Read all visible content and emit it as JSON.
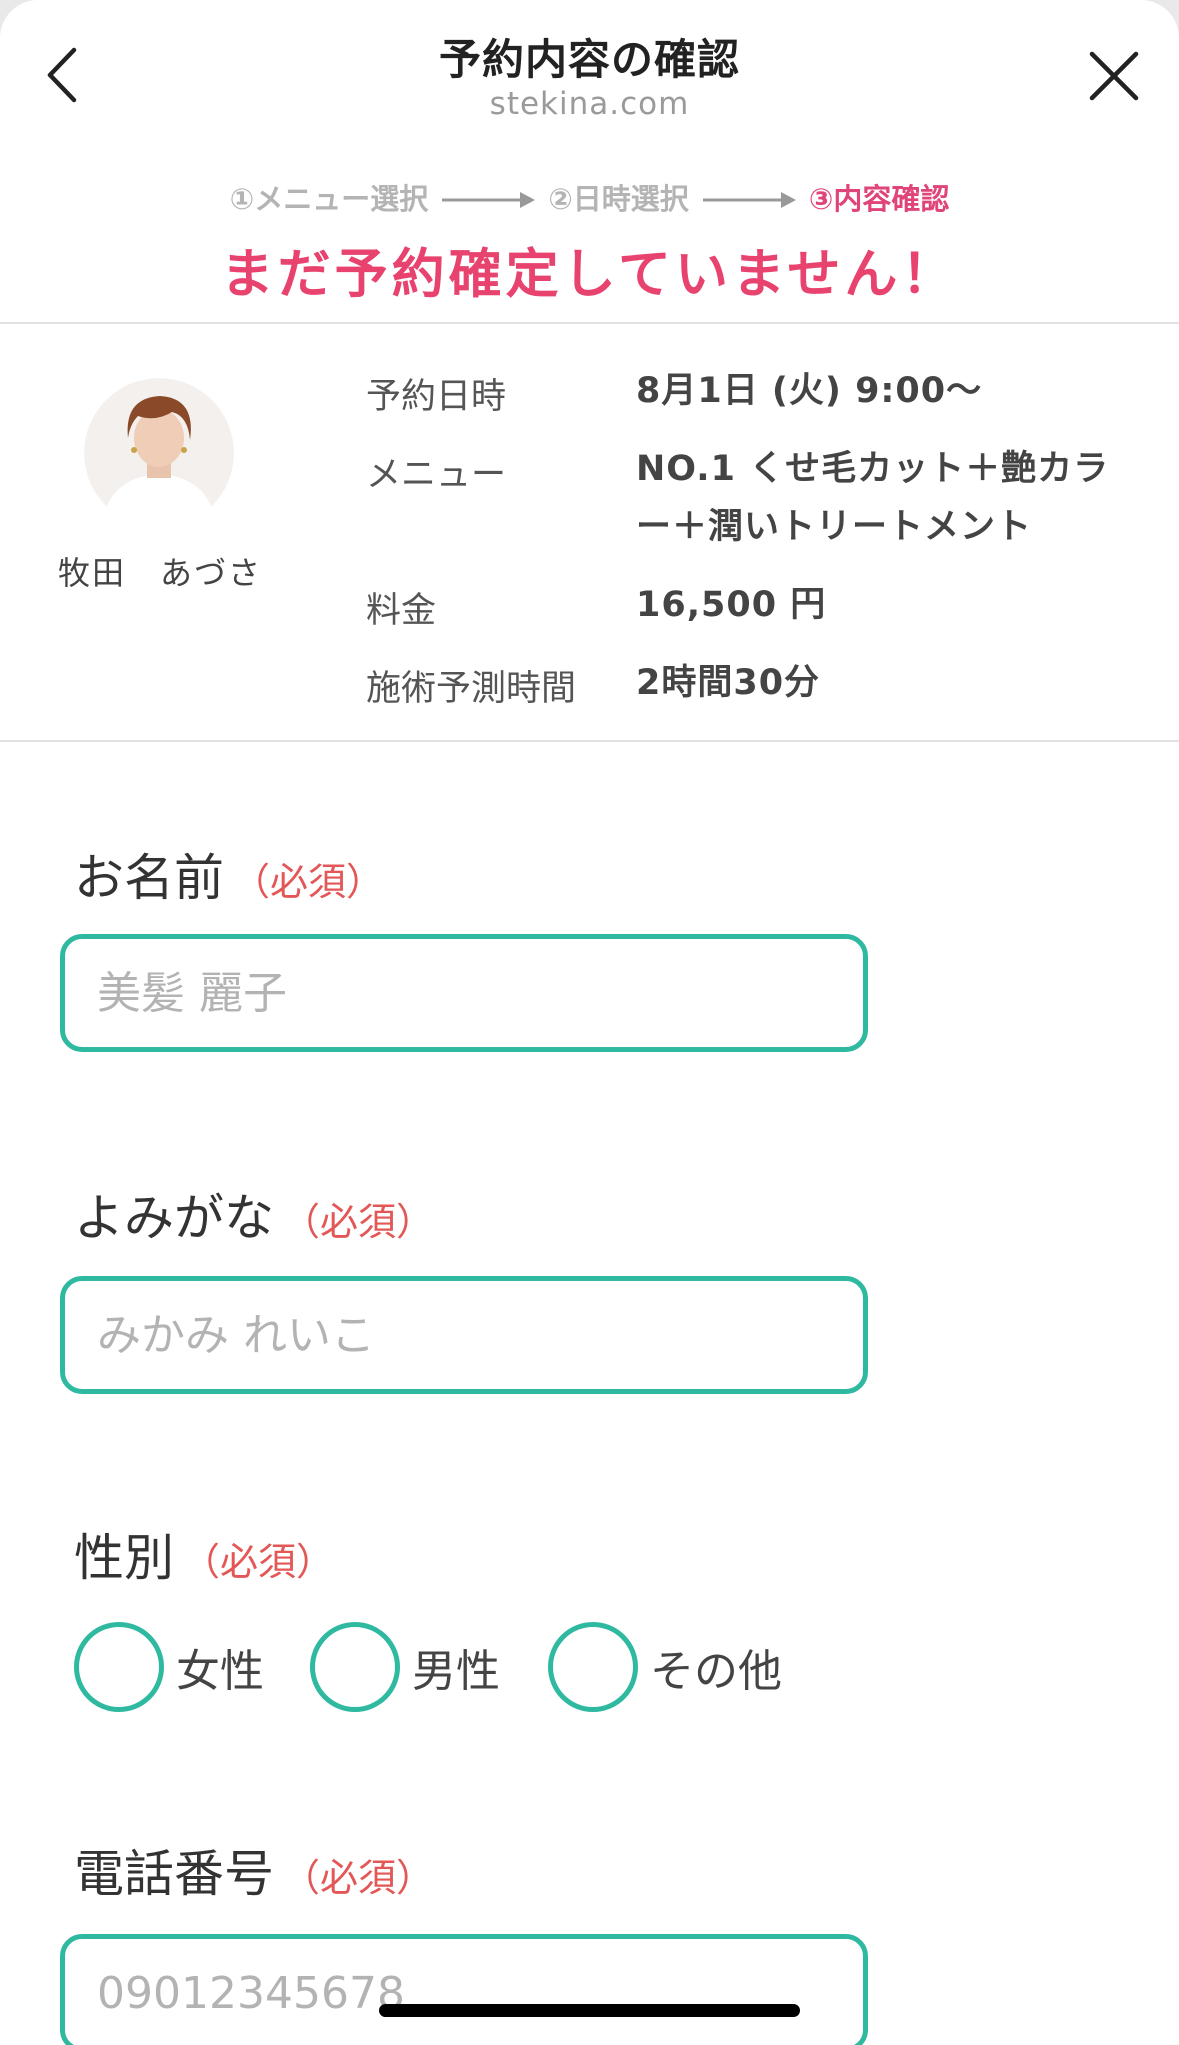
{
  "header": {
    "title": "予約内容の確認",
    "domain": "stekina.com"
  },
  "steps": [
    {
      "label": "①メニュー選択",
      "state": "done"
    },
    {
      "label": "②日時選択",
      "state": "done"
    },
    {
      "label": "③内容確認",
      "state": "current"
    }
  ],
  "warning": "まだ予約確定していません！",
  "summary": {
    "staff_name": "牧田　あづさ",
    "rows": [
      {
        "label": "予約日時",
        "value": "8月1日 (火) 9:00〜"
      },
      {
        "label": "メニュー",
        "value": "NO.1 くせ毛カット＋艶カラー＋潤いトリートメント"
      },
      {
        "label": "料金",
        "value": "16,500 円"
      },
      {
        "label": "施術予測時間",
        "value": "2時間30分"
      }
    ]
  },
  "form": {
    "required_mark": "（必須）",
    "name": {
      "label": "お名前",
      "placeholder": "美髪 麗子"
    },
    "kana": {
      "label": "よみがな",
      "placeholder": "みかみ れいこ"
    },
    "gender": {
      "label": "性別",
      "options": [
        "女性",
        "男性",
        "その他"
      ]
    },
    "phone": {
      "label": "電話番号",
      "placeholder": "09012345678"
    }
  },
  "colors": {
    "accent_teal": "#2fb9a1",
    "warning_pink": "#e8436f",
    "current_step": "#e0457a",
    "required_red": "#e35757"
  }
}
